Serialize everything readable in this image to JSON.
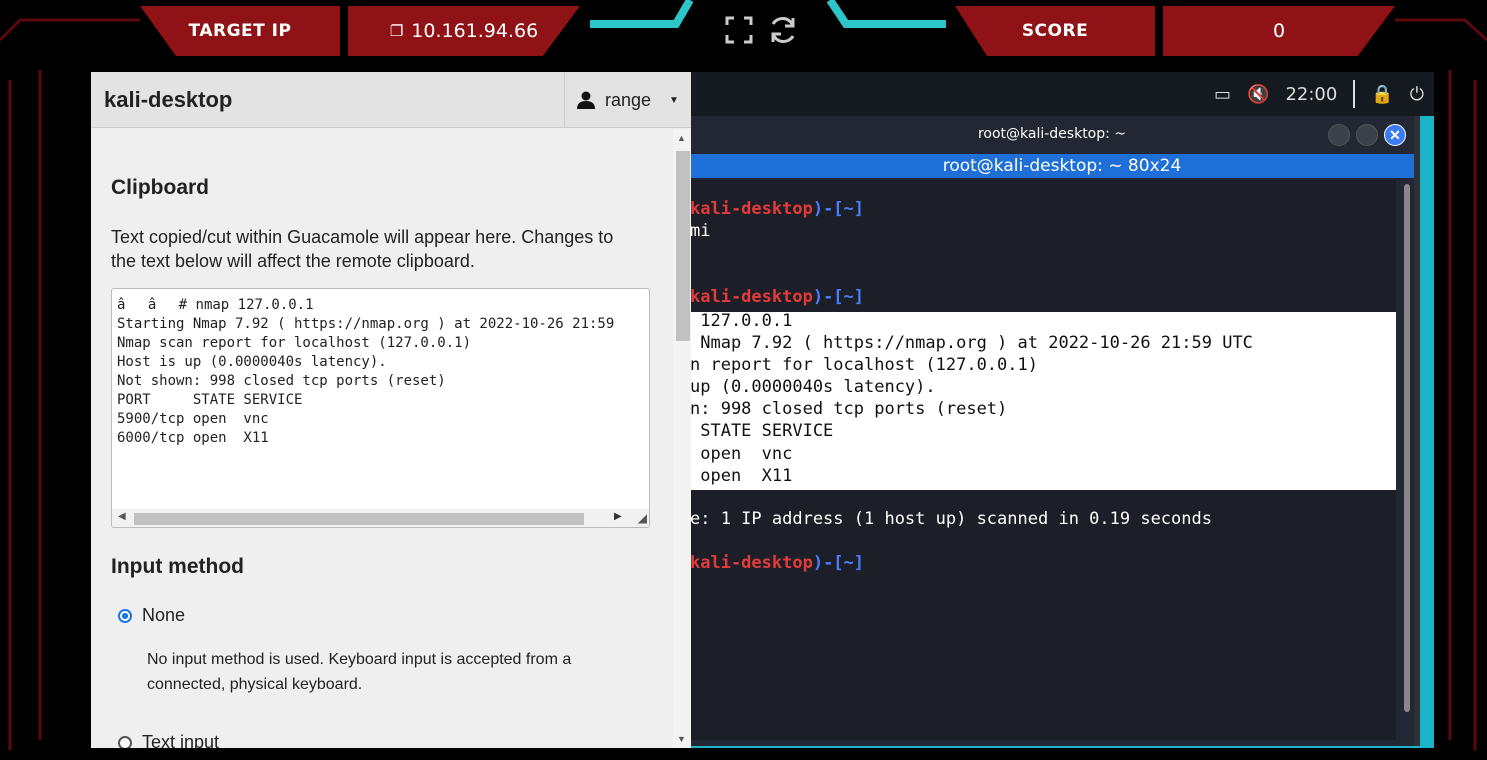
{
  "header": {
    "target_ip_label": "TARGET IP",
    "target_ip_value": "10.161.94.66",
    "score_label": "SCORE",
    "score_value": "0"
  },
  "desktop": {
    "clock": "22:00",
    "window_title": "root@kali-desktop: ~",
    "tab_title": "root@kali-desktop: ~ 80x24",
    "terminal_lines": {
      "l1_host": "kali-desktop",
      "l1_dir": "~",
      "l2": "mi",
      "l3_host": "kali-desktop",
      "l3_dir": "~",
      "s1": " 127.0.0.1",
      "s2": " Nmap 7.92 ( https://nmap.org ) at 2022-10-26 21:59 UTC",
      "s3": "n report for localhost (127.0.0.1)",
      "s4": "up (0.0000040s latency).",
      "s5": "n: 998 closed tcp ports (reset)",
      "s6": " STATE SERVICE",
      "s7": " open  vnc",
      "s8": " open  X11",
      "l4": "e: 1 IP address (1 host up) scanned in 0.19 seconds",
      "l5_host": "kali-desktop",
      "l5_dir": "~"
    }
  },
  "menu": {
    "title": "kali-desktop",
    "user": "range",
    "clipboard": {
      "title": "Clipboard",
      "description": "Text copied/cut within Guacamole will appear here. Changes to the text below will affect the remote clipboard.",
      "content": "ââ# nmap 127.0.0.1\nStarting Nmap 7.92 ( https://nmap.org ) at 2022-10-26 21:59\nNmap scan report for localhost (127.0.0.1)\nHost is up (0.0000040s latency).\nNot shown: 998 closed tcp ports (reset)\nPORT     STATE SERVICE\n5900/tcp open  vnc\n6000/tcp open  X11"
    },
    "input_method": {
      "title": "Input method",
      "options": [
        {
          "label": "None",
          "description": "No input method is used. Keyboard input is accepted from a connected, physical keyboard."
        },
        {
          "label": "Text input"
        }
      ]
    }
  },
  "colors": {
    "header_red": "#8e1216",
    "desktop_cyan": "#1eb4c8",
    "tab_blue": "#1f6fd8",
    "radio_blue": "#1a73e8"
  }
}
